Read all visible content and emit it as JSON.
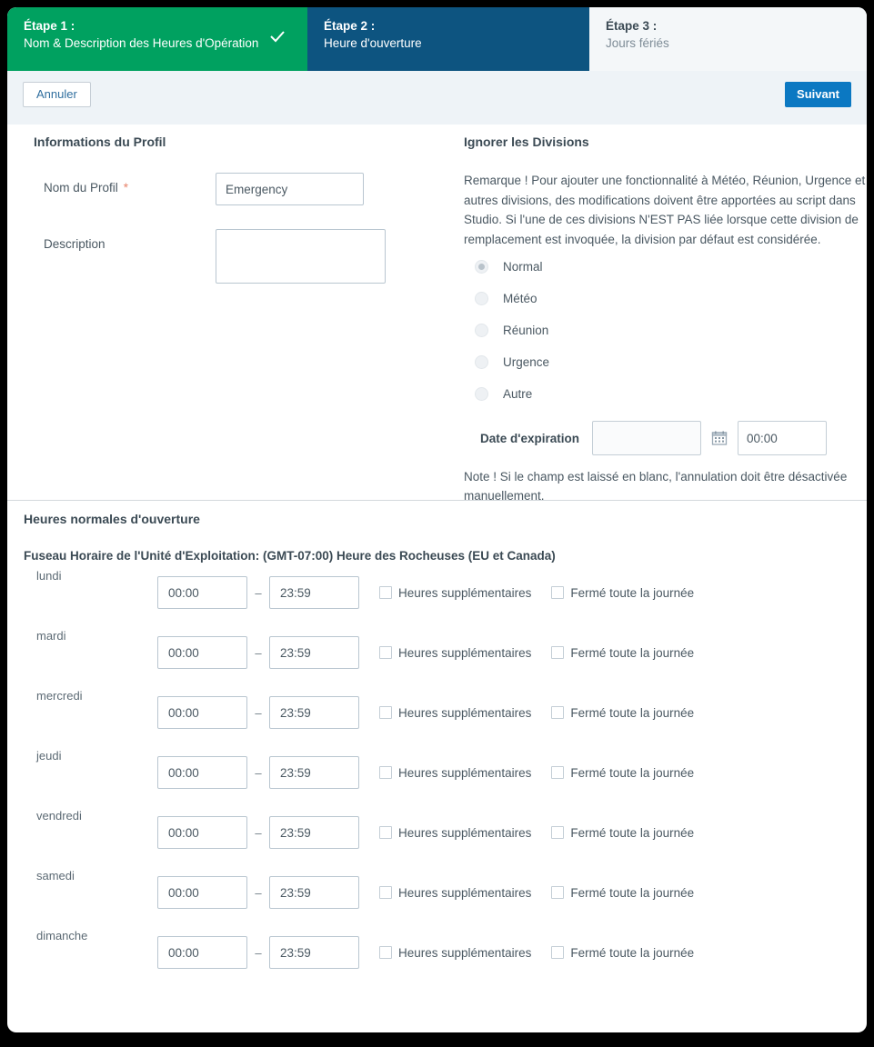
{
  "stepper": {
    "steps": [
      {
        "num": "Étape 1 :",
        "label": "Nom & Description des Heures d'Opération",
        "state": "completed",
        "icon": "check-icon"
      },
      {
        "num": "Étape 2 :",
        "label": "Heure d'ouverture",
        "state": "active"
      },
      {
        "num": "Étape 3 :",
        "label": "Jours fériés",
        "state": "inactive"
      }
    ]
  },
  "toolbar": {
    "cancel_label": "Annuler",
    "next_label": "Suivant"
  },
  "profile": {
    "section_title": "Informations du Profil",
    "name_label": "Nom du Profil",
    "required_marker": "*",
    "name_value": "Emergency",
    "description_label": "Description",
    "description_value": ""
  },
  "divisions": {
    "section_title": "Ignorer les Divisions",
    "note": "Remarque ! Pour ajouter une fonctionnalité à Météo, Réunion, Urgence et autres divisions, des modifications doivent être apportées au script dans Studio. Si l'une de ces divisions N'EST PAS liée lorsque cette division de remplacement est invoquée, la division par défaut est considérée.",
    "options": [
      {
        "label": "Normal",
        "selected": true
      },
      {
        "label": "Météo",
        "selected": false
      },
      {
        "label": "Réunion",
        "selected": false
      },
      {
        "label": "Urgence",
        "selected": false
      },
      {
        "label": "Autre",
        "selected": false
      }
    ],
    "expiration_label": "Date d'expiration",
    "expiration_date_value": "",
    "expiration_time_value": "00:00",
    "calendar_icon": "calendar-icon",
    "note2": "Note ! Si le champ est laissé en blanc, l'annulation doit être désactivée manuellement."
  },
  "hours": {
    "section_title": "Heures normales d'ouverture",
    "timezone_line": "Fuseau Horaire de l'Unité d'Exploitation: (GMT-07:00) Heure des Rocheuses (EU et Canada)",
    "separator": "–",
    "overtime_label": "Heures supplémentaires",
    "closed_label": "Fermé toute la journée",
    "days": [
      {
        "name": "lundi",
        "start": "00:00",
        "end": "23:59",
        "overtime": false,
        "closed": false
      },
      {
        "name": "mardi",
        "start": "00:00",
        "end": "23:59",
        "overtime": false,
        "closed": false
      },
      {
        "name": "mercredi",
        "start": "00:00",
        "end": "23:59",
        "overtime": false,
        "closed": false
      },
      {
        "name": "jeudi",
        "start": "00:00",
        "end": "23:59",
        "overtime": false,
        "closed": false
      },
      {
        "name": "vendredi",
        "start": "00:00",
        "end": "23:59",
        "overtime": false,
        "closed": false
      },
      {
        "name": "samedi",
        "start": "00:00",
        "end": "23:59",
        "overtime": false,
        "closed": false
      },
      {
        "name": "dimanche",
        "start": "00:00",
        "end": "23:59",
        "overtime": false,
        "closed": false
      }
    ]
  },
  "colors": {
    "step_completed": "#00a160",
    "step_active": "#0d5480",
    "step_inactive_bg": "#f4f7f9",
    "primary_button": "#0b78c2",
    "toolbar_bg": "#eef3f7",
    "required_star": "#e8836b"
  }
}
